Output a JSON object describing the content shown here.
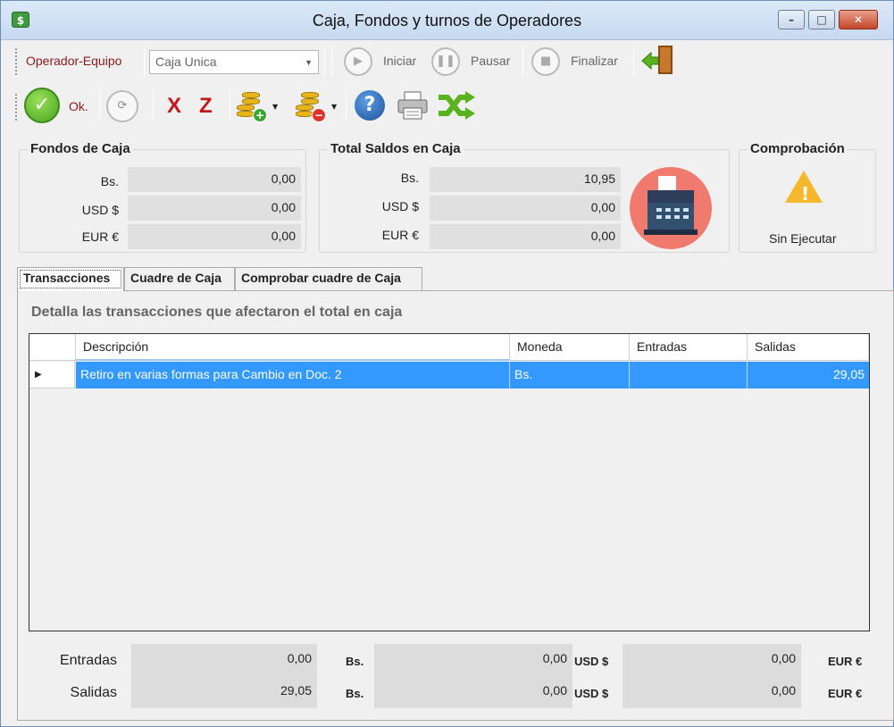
{
  "window": {
    "title": "Caja, Fondos y turnos de Operadores",
    "icon": "cash-app-icon"
  },
  "toolbar1": {
    "operator_label": "Operador-Equipo",
    "caja_selected": "Caja Unica",
    "start_label": "Iniciar",
    "pause_label": "Pausar",
    "finish_label": "Finalizar"
  },
  "toolbar2": {
    "ok_label": "Ok.",
    "x_label": "X",
    "z_label": "Z"
  },
  "fondos": {
    "title": "Fondos de Caja",
    "rows": [
      {
        "label": "Bs.",
        "value": "0,00"
      },
      {
        "label": "USD $",
        "value": "0,00"
      },
      {
        "label": "EUR €",
        "value": "0,00"
      }
    ]
  },
  "saldos": {
    "title": "Total Saldos en Caja",
    "rows": [
      {
        "label": "Bs.",
        "value": "10,95"
      },
      {
        "label": "USD $",
        "value": "0,00"
      },
      {
        "label": "EUR €",
        "value": "0,00"
      }
    ]
  },
  "comprobacion": {
    "title": "Comprobación",
    "status": "Sin Ejecutar"
  },
  "tabs": [
    "Transacciones",
    "Cuadre de Caja",
    "Comprobar cuadre de Caja"
  ],
  "transacciones": {
    "description": "Detalla las transacciones que afectaron el total en caja",
    "columns": [
      "Descripción",
      "Moneda",
      "Entradas",
      "Salidas"
    ],
    "rows": [
      {
        "descripcion": "Retiro en varias formas para Cambio en Doc. 2",
        "moneda": "Bs.",
        "entradas": "",
        "salidas": "29,05"
      }
    ]
  },
  "totales": {
    "entradas_label": "Entradas",
    "salidas_label": "Salidas",
    "entradas": {
      "bs": "0,00",
      "usd": "0,00",
      "eur": "0,00"
    },
    "salidas": {
      "bs": "29,05",
      "usd": "0,00",
      "eur": "0,00"
    },
    "currency_bs": "Bs.",
    "currency_usd": "USD $",
    "currency_eur": "EUR €"
  },
  "colors": {
    "accent_red": "#8b1a1a",
    "selection": "#3399ff",
    "ok_green": "#46a41e"
  }
}
